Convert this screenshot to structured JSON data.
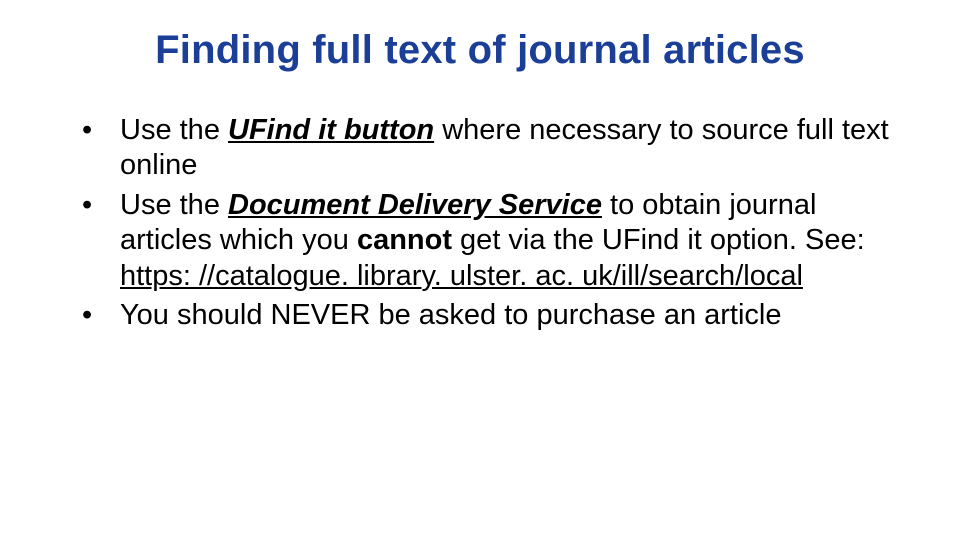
{
  "title": "Finding full text of journal articles",
  "bullets": [
    {
      "pre": "Use the ",
      "emph": "UFind it button",
      "post": " where necessary to source full text online"
    },
    {
      "pre": "Use the ",
      "emph": "Document Delivery Service",
      "mid1": " to obtain journal articles which you ",
      "cannot": "cannot",
      "mid2": " get via the UFind it option. See: ",
      "link": "https: //catalogue. library. ulster. ac. uk/ill/search/local"
    },
    {
      "text": "You should NEVER be asked to purchase an article"
    }
  ]
}
